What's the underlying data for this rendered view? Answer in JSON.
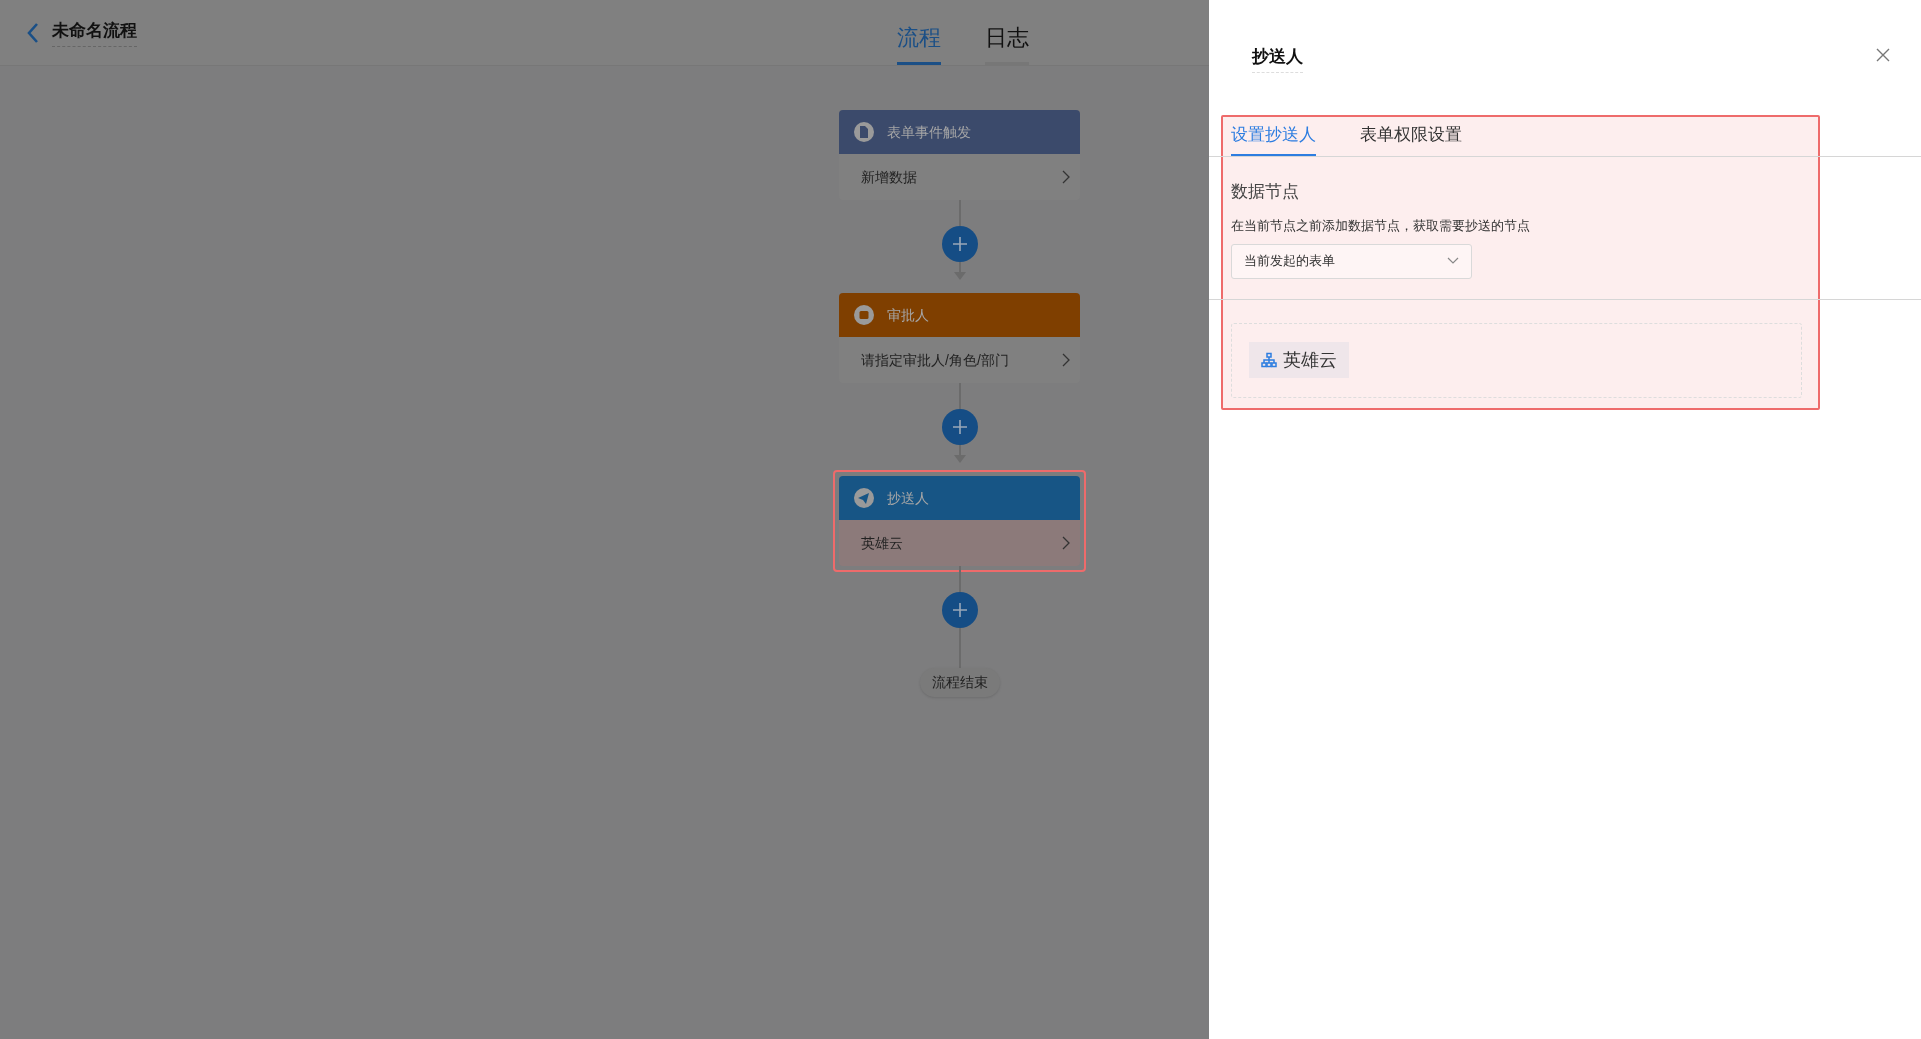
{
  "header": {
    "title": "未命名流程",
    "tabs": [
      {
        "label": "流程",
        "selected": true
      },
      {
        "label": "日志",
        "selected": false
      }
    ]
  },
  "flow": {
    "nodes": [
      {
        "kind": "trigger",
        "title": "表单事件触发",
        "value": "新增数据",
        "highlighted": false
      },
      {
        "kind": "approver",
        "title": "审批人",
        "value": "请指定审批人/角色/部门",
        "highlighted": false
      },
      {
        "kind": "cc",
        "title": "抄送人",
        "value": "英雄云",
        "highlighted": true
      }
    ],
    "end_label": "流程结束"
  },
  "panel": {
    "title": "抄送人",
    "tabs": [
      {
        "label": "设置抄送人",
        "selected": true
      },
      {
        "label": "表单权限设置",
        "selected": false
      }
    ],
    "section_title": "数据节点",
    "description": "在当前节点之前添加数据节点，获取需要抄送的节点",
    "select": {
      "value": "当前发起的表单"
    },
    "recipients": [
      {
        "label": "英雄云"
      }
    ]
  }
}
